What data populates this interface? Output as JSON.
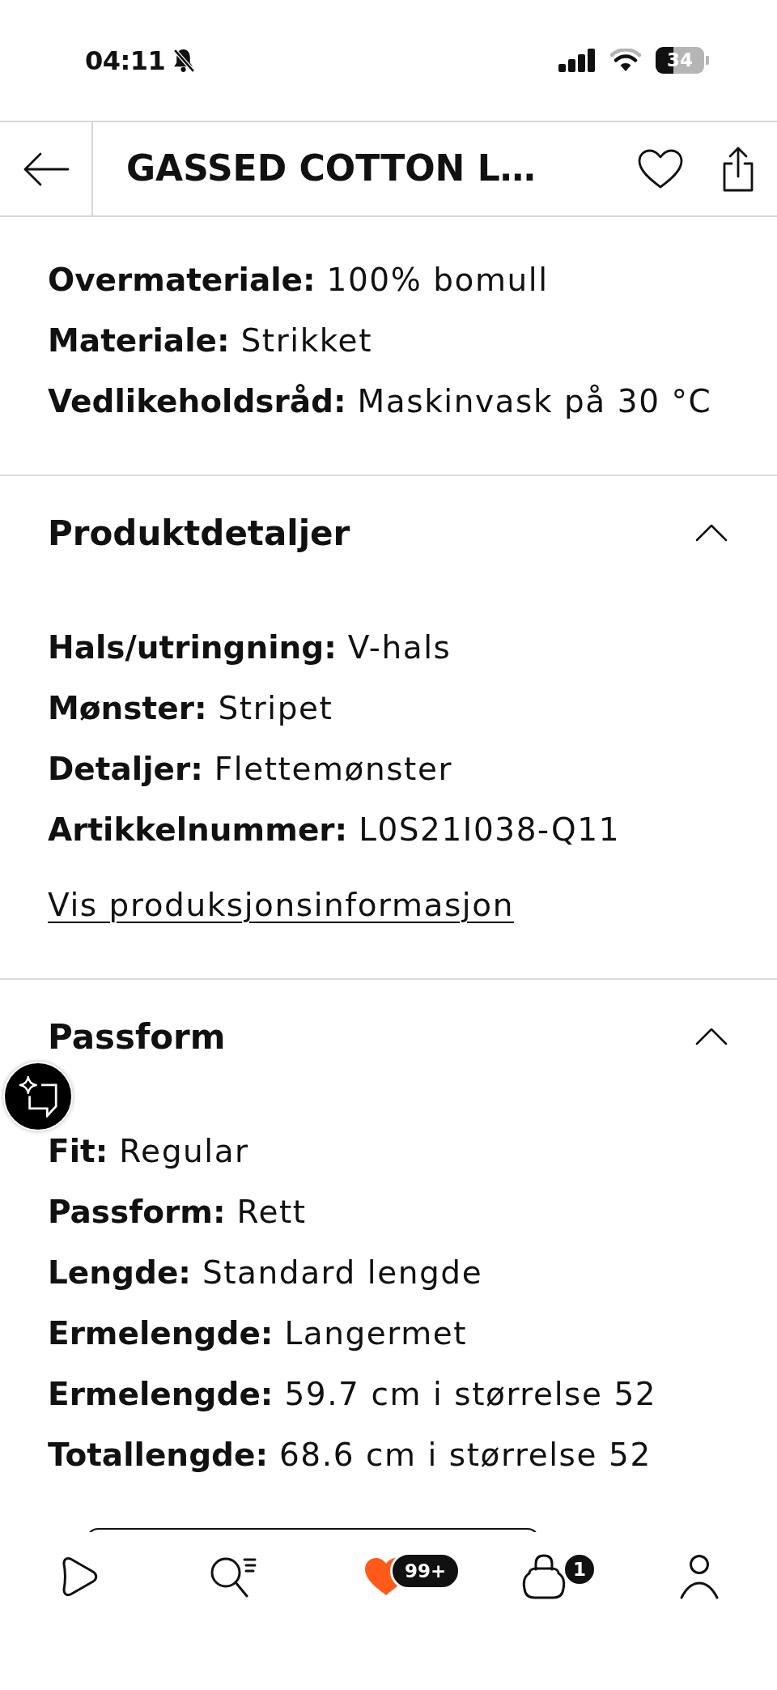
{
  "status_bar": {
    "time": "04:11",
    "battery": "34"
  },
  "header": {
    "title": "GASSED COTTON L…"
  },
  "sections": [
    {
      "rows": [
        "**Overmateriale:** 100% bomull",
        "**Materiale:** Strikket",
        "**Vedlikeholdsråd:** Maskinvask på 30 °C"
      ]
    },
    {
      "title": "Produktdetaljer",
      "expanded": true,
      "rows": [
        "**Hals/utringning:** V-hals",
        "**Mønster:** Stripet",
        "**Detaljer:** Flettemønster",
        "**Artikkelnummer:** L0S21I038-Q11"
      ],
      "link": "Vis produksjonsinformasjon"
    },
    {
      "title": "Passform",
      "expanded": true,
      "rows": [
        "**Fit:** Regular",
        "**Passform:** Rett",
        "**Lengde:** Standard lengde",
        "**Ermelengde:** Langermet",
        "**Ermelengde:** 59.7 cm i størrelse 52",
        "**Totallengde:** 68.6 cm i størrelse 52"
      ]
    }
  ],
  "bottom_nav": [
    {
      "kind": "home"
    },
    {
      "kind": "search"
    },
    {
      "kind": "wishlist",
      "badge": "99+"
    },
    {
      "kind": "bag",
      "badge": "1"
    },
    {
      "kind": "profile"
    }
  ]
}
